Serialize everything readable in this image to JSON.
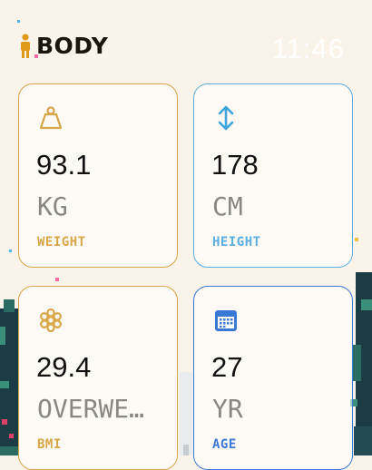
{
  "header": {
    "title": "BODY",
    "time": "11:46"
  },
  "colors": {
    "weight": "#d7a646",
    "height": "#5aaee0",
    "bmi": "#d7a646",
    "age": "#3a78d6"
  },
  "cards": {
    "weight": {
      "icon": "weight-icon",
      "value": "93.1",
      "unit": "KG",
      "label": "WEIGHT"
    },
    "height": {
      "icon": "up-down-arrow-icon",
      "value": "178",
      "unit": "CM",
      "label": "HEIGHT"
    },
    "bmi": {
      "icon": "asterisk-icon",
      "value": "29.4",
      "unit": "OVERWE…",
      "label": "BMI"
    },
    "age": {
      "icon": "calendar-icon",
      "value": "27",
      "unit": "YR",
      "label": "AGE"
    }
  }
}
